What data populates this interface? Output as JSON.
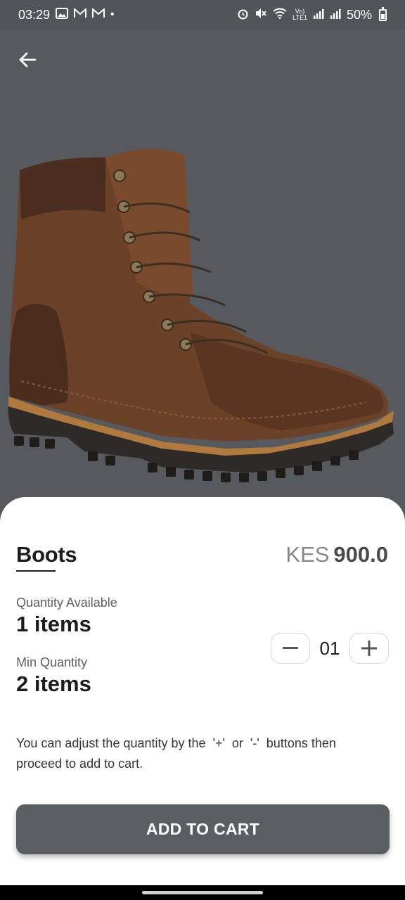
{
  "status_bar": {
    "time": "03:29",
    "battery": "50%",
    "icons": [
      "image-icon",
      "gmail-icon",
      "gmail-icon",
      "dot-icon",
      "alarm-icon",
      "mute-icon",
      "wifi-icon",
      "volte-icon",
      "signal-icon",
      "signal-icon",
      "battery-icon"
    ]
  },
  "header": {
    "back_icon": "arrow-left-icon"
  },
  "product": {
    "name": "Boots",
    "currency": "KES",
    "price": "900.0",
    "image": "brown-leather-boot"
  },
  "quantity_available": {
    "label": "Quantity Available",
    "value": "1 items"
  },
  "min_quantity": {
    "label": "Min Quantity",
    "value": "2 items"
  },
  "stepper": {
    "minus": "−",
    "value": "01",
    "plus": "+"
  },
  "help_text": "You can adjust the quantity by the  '+'  or  '-'  buttons then proceed to add to cart.",
  "add_to_cart": {
    "label": "ADD TO CART"
  },
  "colors": {
    "hero_bg": "#565a5e",
    "button_bg": "#5a5e62",
    "sheet_bg": "#ffffff"
  }
}
